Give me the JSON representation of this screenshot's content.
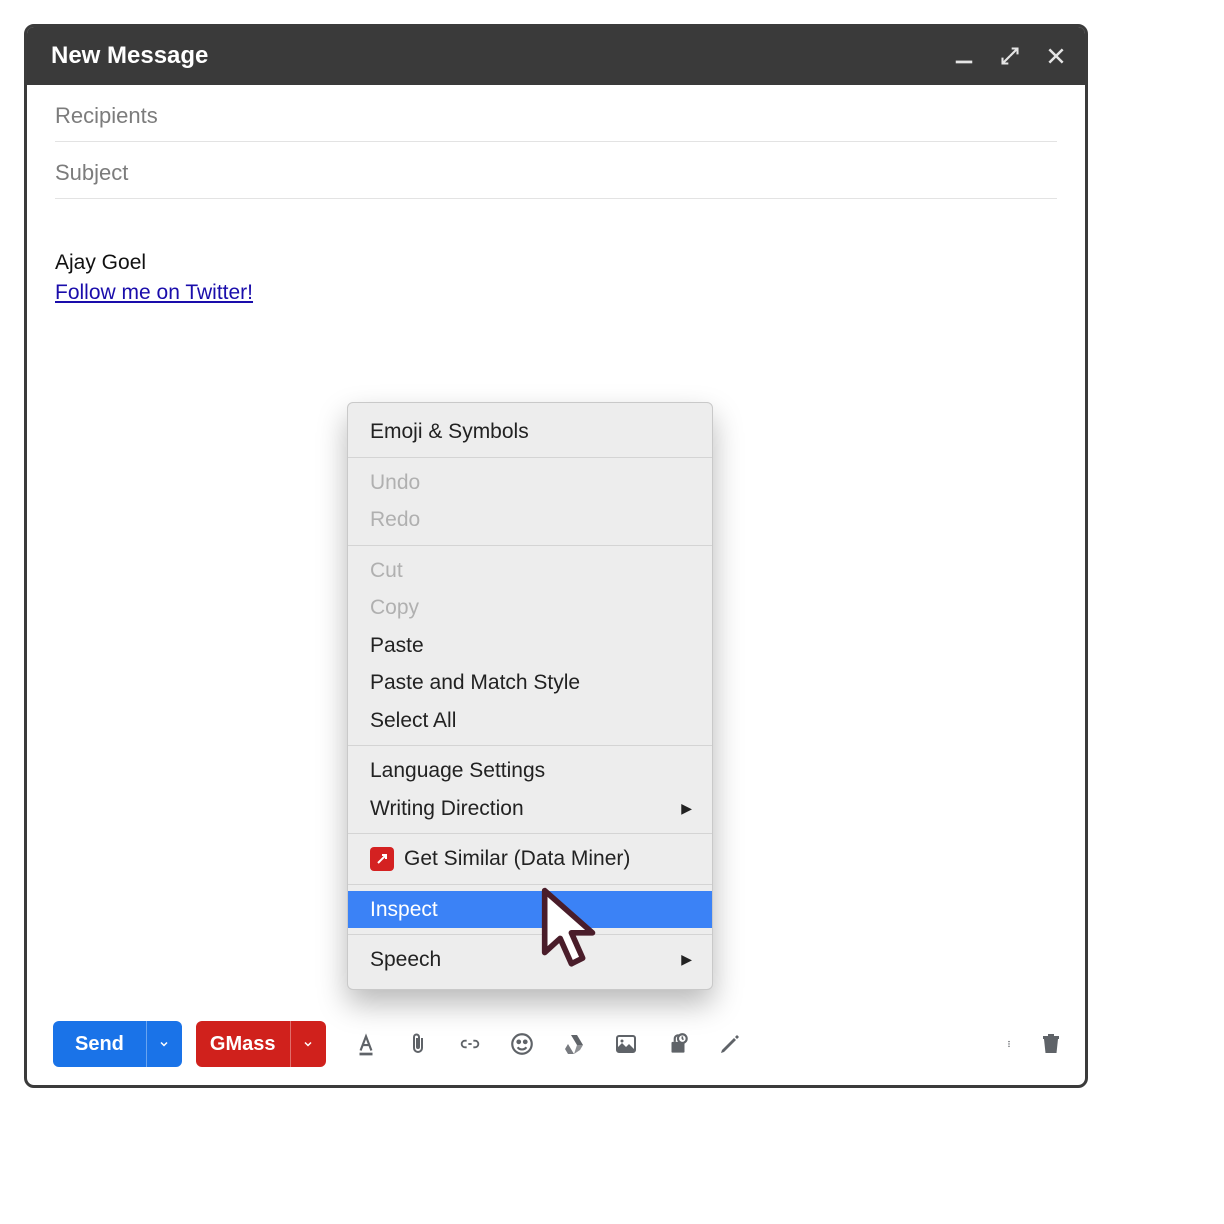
{
  "header": {
    "title": "New Message"
  },
  "fields": {
    "recipients_placeholder": "Recipients",
    "subject_placeholder": "Subject"
  },
  "signature": {
    "name": "Ajay Goel",
    "link_text": "Follow me on Twitter!"
  },
  "context_menu": {
    "groups": [
      {
        "items": [
          {
            "label": "Emoji & Symbols",
            "enabled": true
          }
        ]
      },
      {
        "items": [
          {
            "label": "Undo",
            "enabled": false
          },
          {
            "label": "Redo",
            "enabled": false
          }
        ]
      },
      {
        "items": [
          {
            "label": "Cut",
            "enabled": false
          },
          {
            "label": "Copy",
            "enabled": false
          },
          {
            "label": "Paste",
            "enabled": true
          },
          {
            "label": "Paste and Match Style",
            "enabled": true
          },
          {
            "label": "Select All",
            "enabled": true
          }
        ]
      },
      {
        "items": [
          {
            "label": "Language Settings",
            "enabled": true
          },
          {
            "label": "Writing Direction",
            "enabled": true,
            "submenu": true
          }
        ]
      },
      {
        "items": [
          {
            "label": "Get Similar (Data Miner)",
            "enabled": true,
            "icon": "dataminer"
          }
        ]
      },
      {
        "items": [
          {
            "label": "Inspect",
            "enabled": true,
            "highlight": true
          }
        ]
      },
      {
        "items": [
          {
            "label": "Speech",
            "enabled": true,
            "submenu": true
          }
        ]
      }
    ]
  },
  "toolbar": {
    "send_label": "Send",
    "gmass_label": "GMass"
  }
}
